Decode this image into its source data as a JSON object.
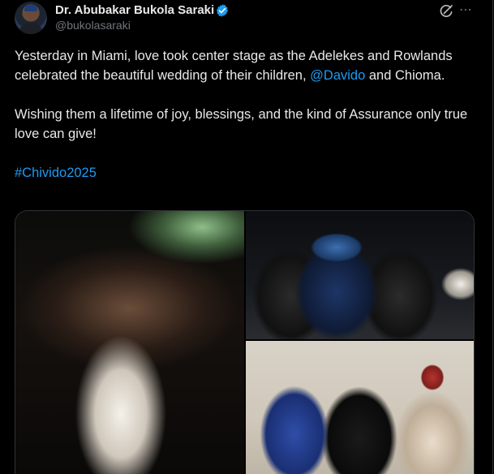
{
  "author": {
    "name": "Dr. Abubakar Bukola Saraki",
    "handle": "@bukolasaraki"
  },
  "tweet": {
    "line1_pre": "Yesterday in Miami, love took center stage as the Adelekes and Rowlands celebrated the beautiful wedding of their children, ",
    "mention": "@Davido",
    "line1_post": " and Chioma.",
    "paragraph2": "Wishing them a lifetime of joy, blessings, and the kind of Assurance only true love can give!",
    "hashtag": "#Chivido2025"
  },
  "colors": {
    "background": "#000000",
    "text": "#e7e9ea",
    "muted": "#71767b",
    "link": "#1d9bf0",
    "verified": "#1d9bf0"
  },
  "icons": [
    "verified-badge-icon",
    "grok-icon",
    "more-icon"
  ],
  "media": [
    {
      "name": "wedding-party-photo"
    },
    {
      "name": "dinner-guests-photo"
    },
    {
      "name": "seated-guests-photo"
    }
  ]
}
